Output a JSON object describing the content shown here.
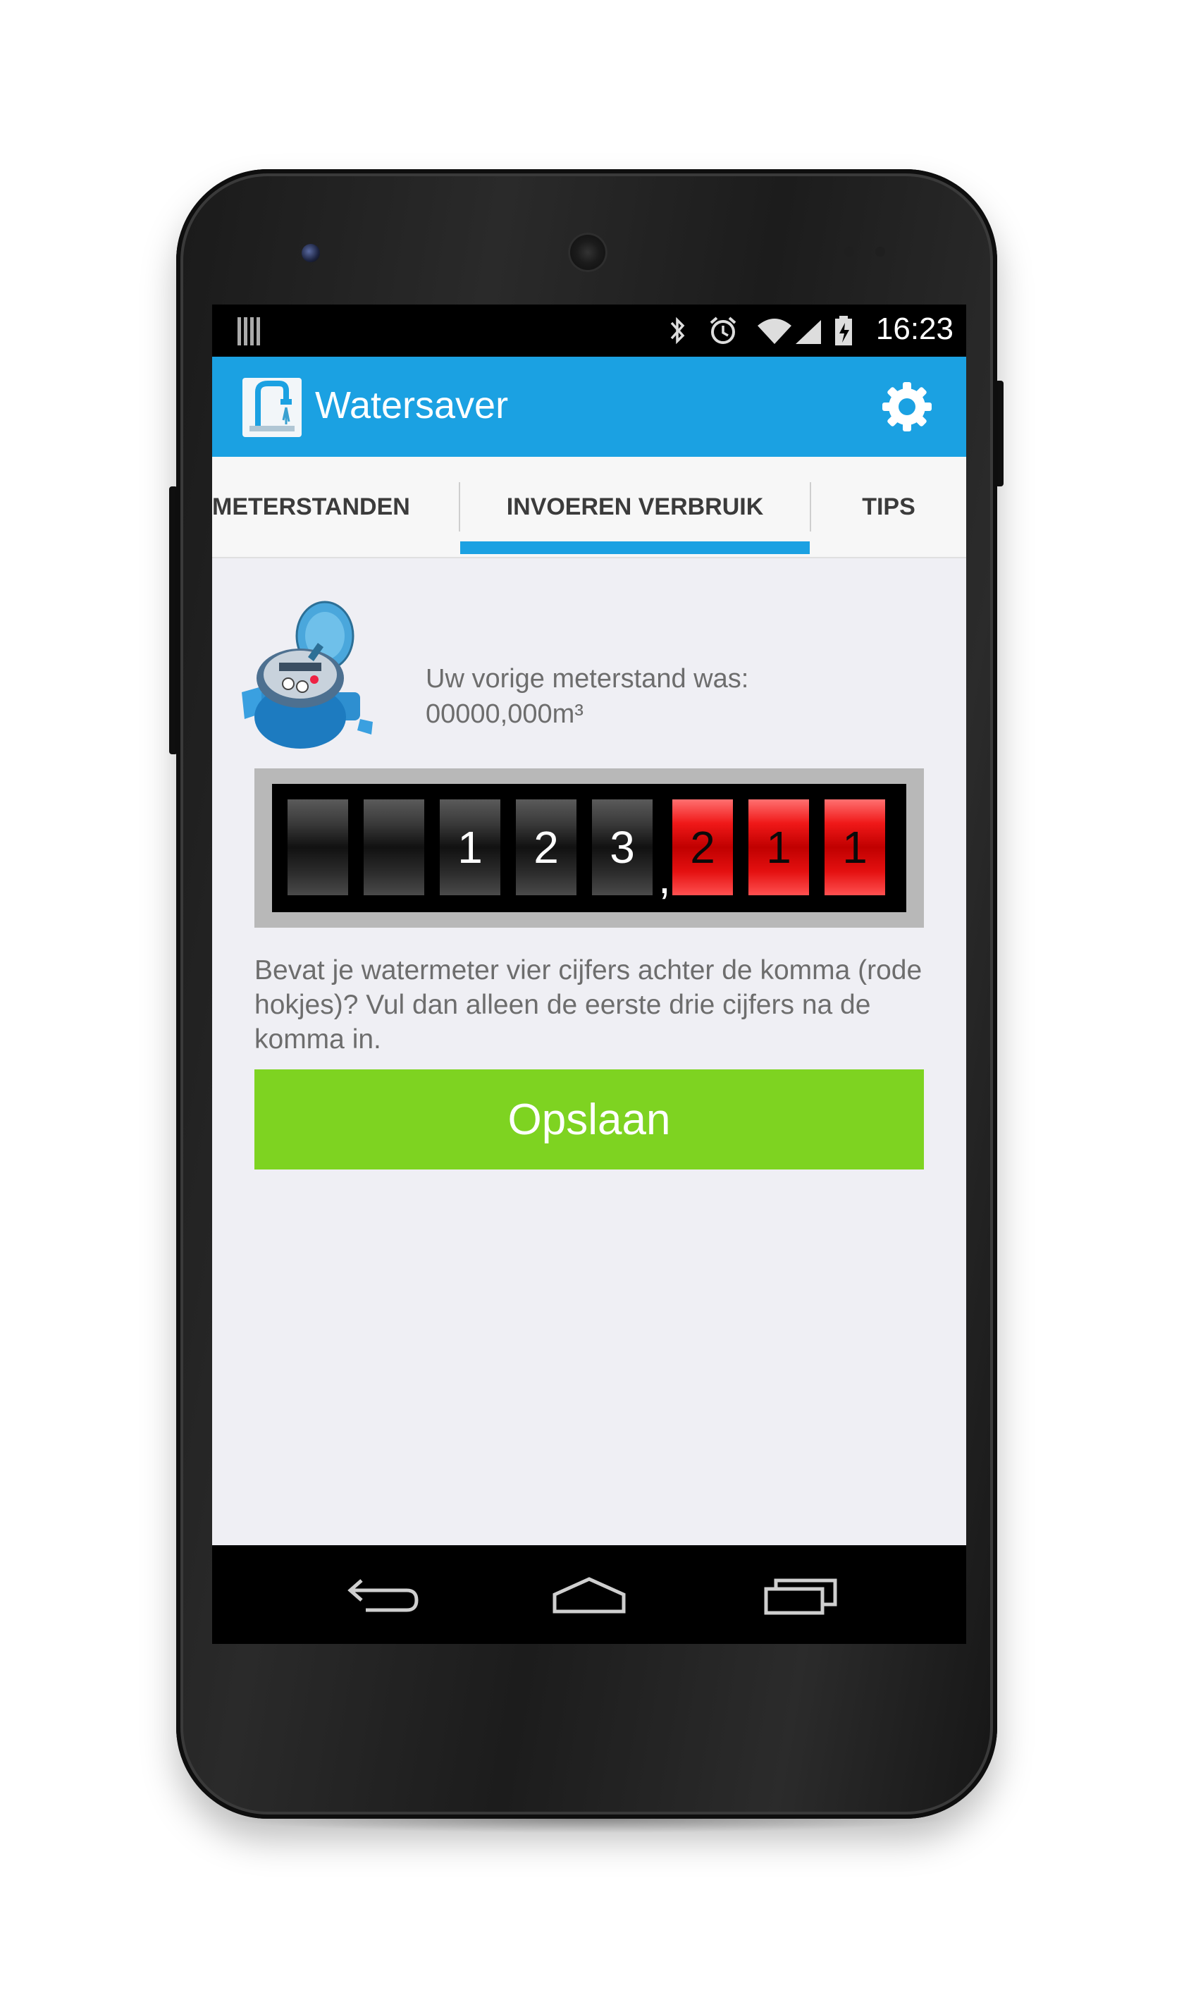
{
  "status_bar": {
    "time": "16:23",
    "icons": [
      "notification-icon",
      "bluetooth-icon",
      "alarm-icon",
      "wifi-icon",
      "signal-icon",
      "battery-icon"
    ]
  },
  "app": {
    "title": "Watersaver",
    "accent_color": "#1ba1e2",
    "logo_icon": "faucet-logo-icon",
    "settings_icon": "gear-icon"
  },
  "tabs": [
    {
      "label": "METERSTANDEN",
      "selected": false
    },
    {
      "label": "INVOEREN VERBRUIK",
      "selected": true
    },
    {
      "label": "TIPS",
      "selected": false
    }
  ],
  "previous_reading": {
    "label": "Uw vorige meterstand was:",
    "value": "00000,000m³"
  },
  "meter_input": {
    "integer_digits": [
      "",
      "",
      "1",
      "2",
      "3"
    ],
    "decimal_separator": ",",
    "decimal_digits": [
      "2",
      "1",
      "1"
    ]
  },
  "hint_text": "Bevat je watermeter vier cijfers achter de komma (rode hokjes)? Vul dan alleen de eerste drie cijfers na de komma in.",
  "save_button": {
    "label": "Opslaan",
    "color": "#7ed321"
  },
  "nav_bar": {
    "icons": [
      "back-icon",
      "home-icon",
      "recent-apps-icon"
    ]
  }
}
